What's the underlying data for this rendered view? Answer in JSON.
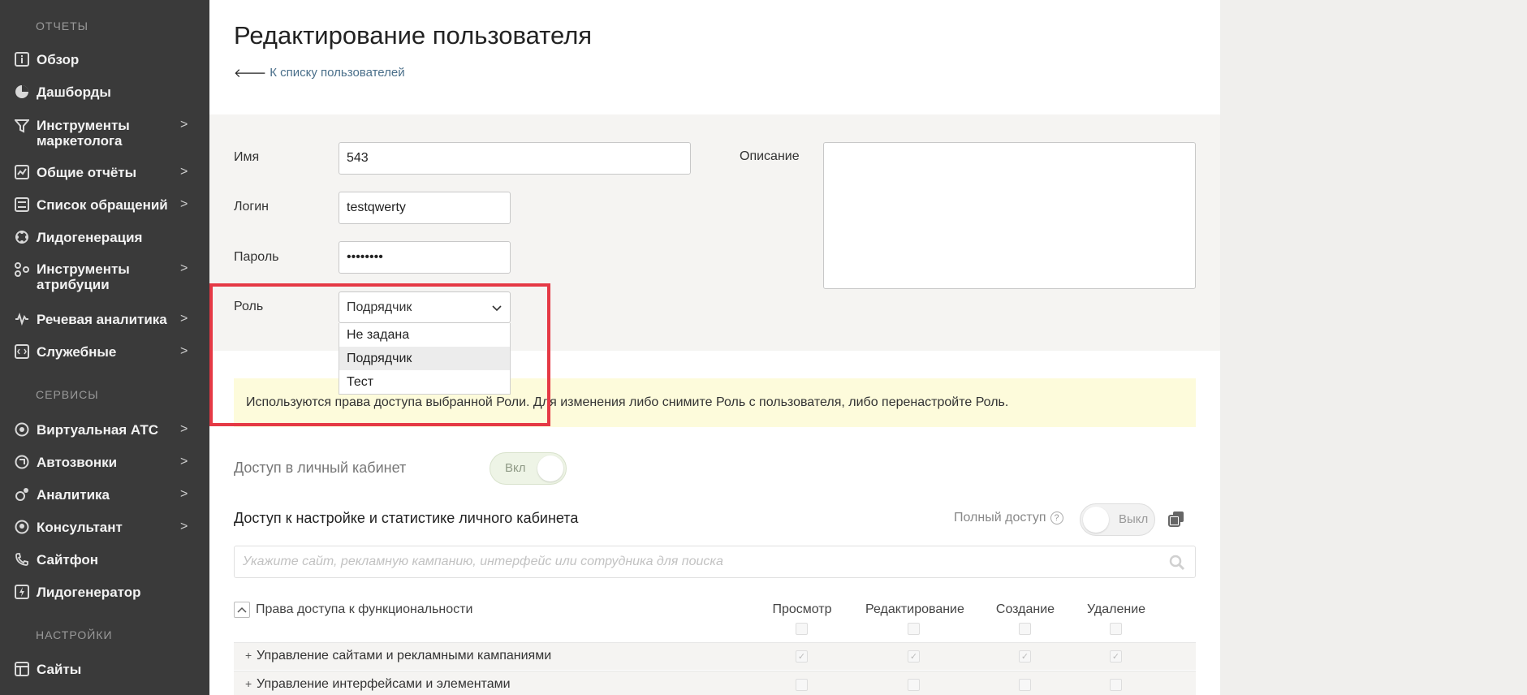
{
  "sidebar": {
    "sections": {
      "reports": "ОТЧЕТЫ",
      "services": "СЕРВИСЫ",
      "settings": "НАСТРОЙКИ"
    },
    "reports_items": [
      {
        "label": "Обзор",
        "icon": "info-icon",
        "arrow": ""
      },
      {
        "label": "Дашборды",
        "icon": "pie-chart-icon",
        "arrow": ""
      },
      {
        "label": "Инструменты маркетолога",
        "icon": "funnel-icon",
        "arrow": ">"
      },
      {
        "label": "Общие отчёты",
        "icon": "line-chart-icon",
        "arrow": ">"
      },
      {
        "label": "Список обращений",
        "icon": "list-icon",
        "arrow": ">"
      },
      {
        "label": "Лидогенерация",
        "icon": "lead-gen-icon",
        "arrow": ""
      },
      {
        "label": "Инструменты атрибуции",
        "icon": "attribution-icon",
        "arrow": ">"
      },
      {
        "label": "Речевая аналитика",
        "icon": "waveform-icon",
        "arrow": ">"
      },
      {
        "label": "Служебные",
        "icon": "code-icon",
        "arrow": ">"
      }
    ],
    "services_items": [
      {
        "label": "Виртуальная АТС",
        "icon": "phone-station-icon",
        "arrow": ">"
      },
      {
        "label": "Автозвонки",
        "icon": "autocall-icon",
        "arrow": ">"
      },
      {
        "label": "Аналитика",
        "icon": "analytics-gear-icon",
        "arrow": ">"
      },
      {
        "label": "Консультант",
        "icon": "consultant-icon",
        "arrow": ">"
      },
      {
        "label": "Сайтфон",
        "icon": "sitephone-icon",
        "arrow": ""
      },
      {
        "label": "Лидогенератор",
        "icon": "lead-generator-icon",
        "arrow": ""
      }
    ],
    "settings_items": [
      {
        "label": "Сайты",
        "icon": "sites-icon",
        "arrow": ""
      }
    ]
  },
  "header": {
    "title": "Редактирование пользователя",
    "back_link": "К списку пользователей"
  },
  "form": {
    "name_label": "Имя",
    "name_value": "543",
    "login_label": "Логин",
    "login_value": "testqwerty",
    "password_label": "Пароль",
    "password_value": "••••••••",
    "description_label": "Описание",
    "role_label": "Роль",
    "role_value": "Подрядчик",
    "role_options": [
      "Не задана",
      "Подрядчик",
      "Тест"
    ]
  },
  "notice": "Используются права доступа выбранной Роли. Для изменения либо снимите Роль с пользователя, либо перенастройте Роль.",
  "cabinet_access": {
    "label": "Доступ в личный кабинет",
    "toggle_label": "Вкл"
  },
  "settings_access": {
    "title": "Доступ к настройке и статистике личного кабинета",
    "full_access_label": "Полный доступ",
    "full_access_help": "?",
    "toggle_label": "Выкл",
    "search_placeholder": "Укажите сайт, рекламную кампанию, интерфейс или сотрудника для поиска"
  },
  "table": {
    "main_header": "Права доступа к функциональности",
    "columns": [
      "Просмотр",
      "Редактирование",
      "Создание",
      "Удаление"
    ],
    "rows": [
      {
        "label": "Управление сайтами и рекламными кампаниями"
      },
      {
        "label": "Управление интерфейсами и элементами"
      }
    ]
  },
  "colors": {
    "sidebar_bg": "#3a3a3a",
    "highlight": "#e53945",
    "notice_bg": "#fdfbdb",
    "link": "#4a6f8a"
  }
}
